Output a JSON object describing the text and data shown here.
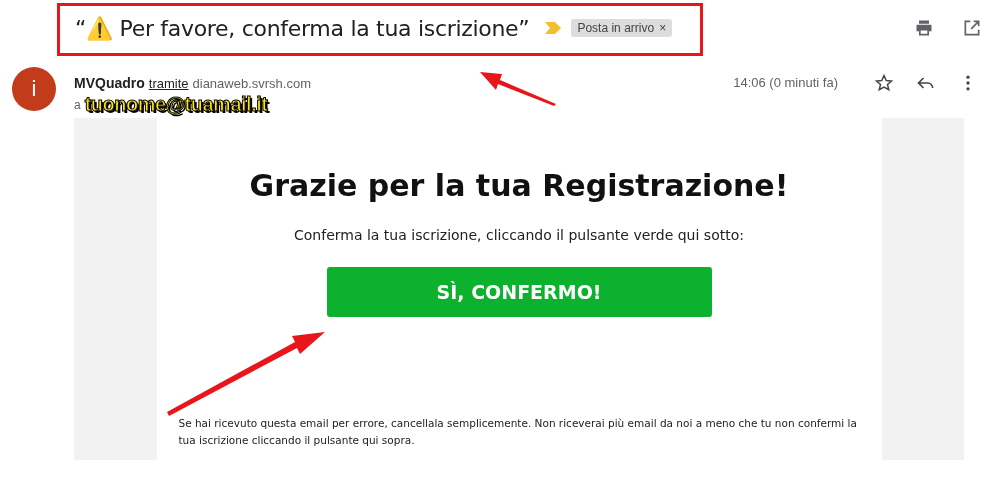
{
  "subject": {
    "text": "“⚠️ Per favore, conferma la tua iscrizione”",
    "label": "Posta in arrivo",
    "label_close": "×"
  },
  "sender": {
    "avatar_letter": "i",
    "name": "MVQuadro",
    "via": "tramite",
    "domain": "dianaweb.svrsh.com",
    "to_prefix": "a",
    "recipient": "tuonome@tuamail.it",
    "time": "14:06 (0 minuti fa)"
  },
  "body": {
    "heading": "Grazie per la tua Registrazione!",
    "intro": "Conferma la tua iscrizione, cliccando il pulsante verde qui sotto:",
    "button": "SÌ, CONFERMO!",
    "footer": "Se hai ricevuto questa email per errore, cancellala semplicemente. Non riceverai più email da noi a meno che tu non confermi la tua iscrizione cliccando il pulsante qui sopra."
  }
}
